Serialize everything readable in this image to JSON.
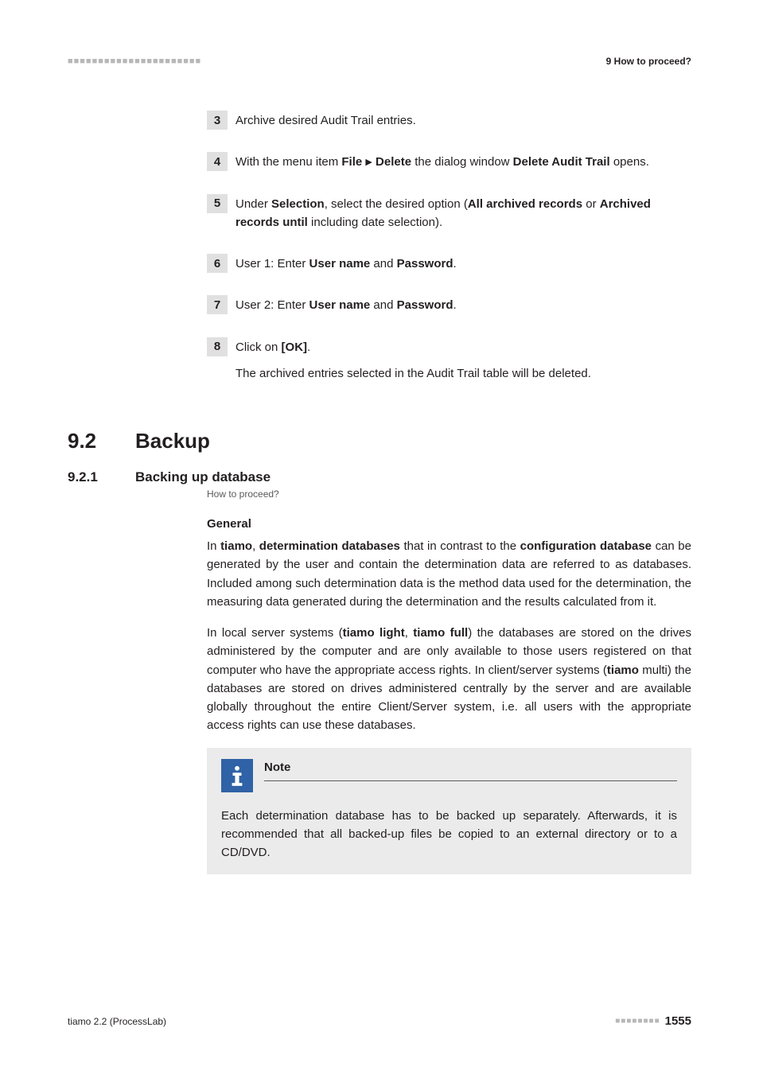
{
  "header": {
    "dashes": "■■■■■■■■■■■■■■■■■■■■■■",
    "section_label": "9 How to proceed?"
  },
  "steps": {
    "s3": {
      "num": "3",
      "text": "Archive desired Audit Trail entries."
    },
    "s4": {
      "num": "4",
      "pre": "With the menu item ",
      "file": "File",
      "arrow": "▶",
      "delete": "Delete",
      "mid": " the dialog window ",
      "dialog": "Delete Audit Trail",
      "post": " opens."
    },
    "s5": {
      "num": "5",
      "pre": "Under ",
      "selection": "Selection",
      "mid1": ", select the desired option (",
      "opt1": "All archived records",
      "or": " or ",
      "opt2": "Archived records until",
      "post": " including date selection)."
    },
    "s6": {
      "num": "6",
      "pre": "User 1: Enter ",
      "uname": "User name",
      "and": " and ",
      "pwd": "Password",
      "post": "."
    },
    "s7": {
      "num": "7",
      "pre": "User 2: Enter ",
      "uname": "User name",
      "and": " and ",
      "pwd": "Password",
      "post": "."
    },
    "s8": {
      "num": "8",
      "pre": "Click on ",
      "ok": "[OK]",
      "post": ".",
      "sub": "The archived entries selected in the Audit Trail table will be deleted."
    }
  },
  "section": {
    "num": "9.2",
    "title": "Backup"
  },
  "subsection": {
    "num": "9.2.1",
    "title": "Backing up database"
  },
  "breadcrumb": "How to proceed?",
  "general": {
    "heading": "General",
    "p1_pre": "In ",
    "p1_tiamo": "tiamo",
    "p1_mid1": ", ",
    "p1_detdb": "determination databases",
    "p1_mid2": " that in contrast to the ",
    "p1_confdb": "configuration database",
    "p1_post": " can be generated by the user and contain the determination data are referred to as databases. Included among such determination data is the method data used for the determination, the measuring data generated during the determination and the results calculated from it.",
    "p2_pre": "In local server systems (",
    "p2_light": "tiamo light",
    "p2_c1": ", ",
    "p2_full": "tiamo full",
    "p2_mid1": ") the databases are stored on the drives administered by the computer and are only available to those users registered on that computer who have the appropriate access rights. In client/server systems (",
    "p2_multi": "tiamo",
    "p2_post": " multi) the databases are stored on drives administered centrally by the server and are available globally throughout the entire Client/Server system, i.e. all users with the appropriate access rights can use these databases."
  },
  "note": {
    "title": "Note",
    "body": "Each determination database has to be backed up separately. Afterwards, it is recommended that all backed-up files be copied to an external directory or to a CD/DVD."
  },
  "footer": {
    "left": "tiamo 2.2 (ProcessLab)",
    "dashes": "■■■■■■■■",
    "page": "1555"
  }
}
